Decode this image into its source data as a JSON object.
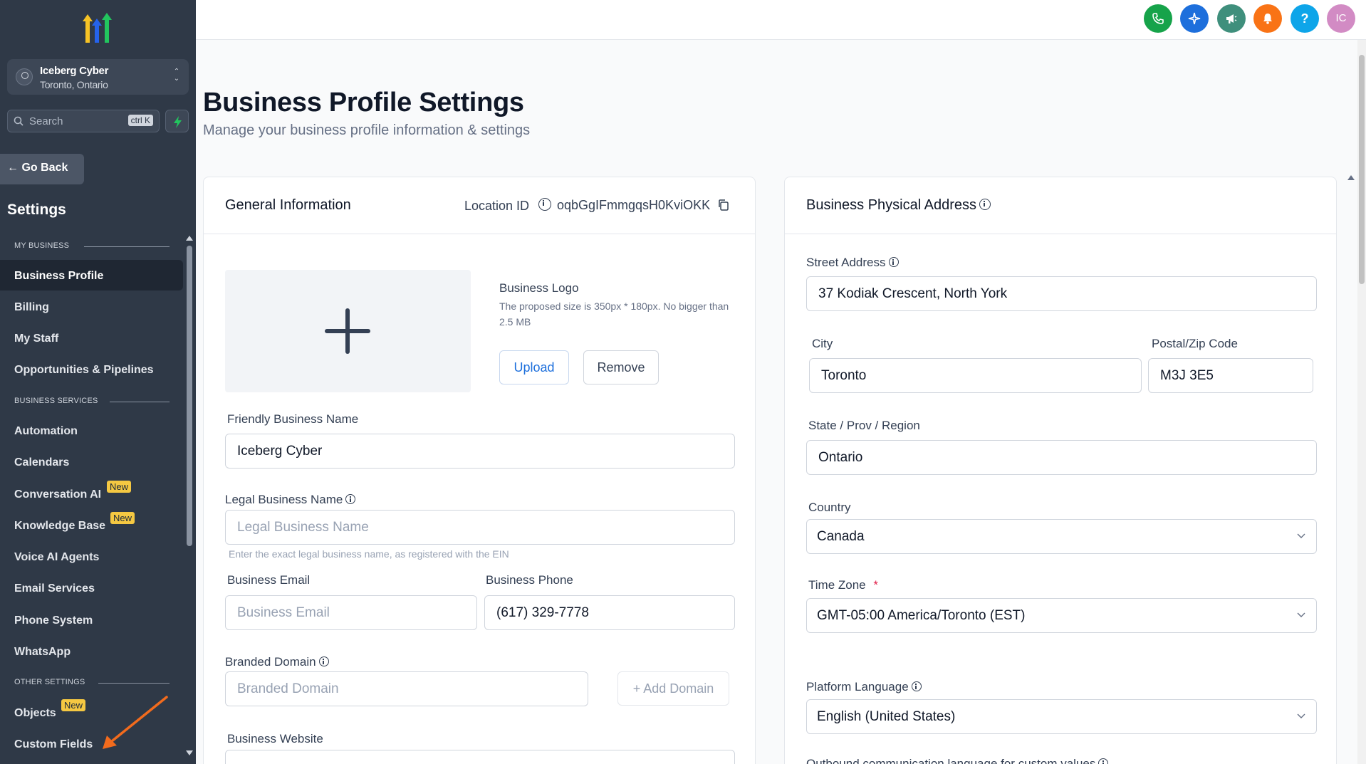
{
  "sidebar": {
    "account_name": "Iceberg Cyber",
    "account_location": "Toronto, Ontario",
    "search_placeholder": "Search",
    "search_shortcut": "ctrl K",
    "go_back": "Go Back",
    "settings_title": "Settings",
    "sections": {
      "my_business": "MY BUSINESS",
      "business_services": "BUSINESS SERVICES",
      "other_settings": "OTHER SETTINGS"
    },
    "items": [
      {
        "label": "Business Profile",
        "active": true
      },
      {
        "label": "Billing"
      },
      {
        "label": "My Staff"
      },
      {
        "label": "Opportunities & Pipelines"
      },
      {
        "label": "Automation"
      },
      {
        "label": "Calendars"
      },
      {
        "label": "Conversation AI",
        "badge": "New"
      },
      {
        "label": "Knowledge Base",
        "badge": "New"
      },
      {
        "label": "Voice AI Agents"
      },
      {
        "label": "Email Services"
      },
      {
        "label": "Phone System"
      },
      {
        "label": "WhatsApp"
      },
      {
        "label": "Objects",
        "badge": "New"
      },
      {
        "label": "Custom Fields"
      }
    ]
  },
  "topbar": {
    "buttons": [
      {
        "icon": "phone-icon",
        "color": "#16a34a"
      },
      {
        "icon": "sparkle-icon",
        "color": "#1d6fdc"
      },
      {
        "icon": "megaphone-icon",
        "color": "#3f8f7c"
      },
      {
        "icon": "bell-icon",
        "color": "#f97316"
      },
      {
        "icon": "help-icon",
        "color": "#0ea5e9",
        "text": "?"
      },
      {
        "icon": "avatar",
        "color": "#d28bc4",
        "text": "IC"
      }
    ]
  },
  "page": {
    "title": "Business Profile Settings",
    "subtitle": "Manage your business profile information & settings"
  },
  "general": {
    "title": "General Information",
    "location_label": "Location ID",
    "location_id": "oqbGgIFmmgqsH0KviOKK",
    "logo_title": "Business Logo",
    "logo_hint": "The proposed size is 350px * 180px. No bigger than 2.5 MB",
    "upload": "Upload",
    "remove": "Remove",
    "friendly_name_label": "Friendly Business Name",
    "friendly_name_value": "Iceberg Cyber",
    "legal_name_label": "Legal Business Name",
    "legal_name_placeholder": "Legal Business Name",
    "legal_name_hint": "Enter the exact legal business name, as registered with the EIN",
    "email_label": "Business Email",
    "email_placeholder": "Business Email",
    "phone_label": "Business Phone",
    "phone_value": "(617) 329-7778",
    "domain_label": "Branded Domain",
    "domain_placeholder": "Branded Domain",
    "add_domain": "Add Domain",
    "website_label": "Business Website"
  },
  "address": {
    "title": "Business Physical Address",
    "street_label": "Street Address",
    "street_value": "37 Kodiak Crescent, North York",
    "city_label": "City",
    "city_value": "Toronto",
    "postal_label": "Postal/Zip Code",
    "postal_value": "M3J 3E5",
    "state_label": "State / Prov / Region",
    "state_value": "Ontario",
    "country_label": "Country",
    "country_value": "Canada",
    "timezone_label": "Time Zone",
    "timezone_required": "*",
    "timezone_value": "GMT-05:00 America/Toronto (EST)",
    "language_label": "Platform Language",
    "language_value": "English (United States)",
    "outbound_label": "Outbound communication language for custom values"
  }
}
